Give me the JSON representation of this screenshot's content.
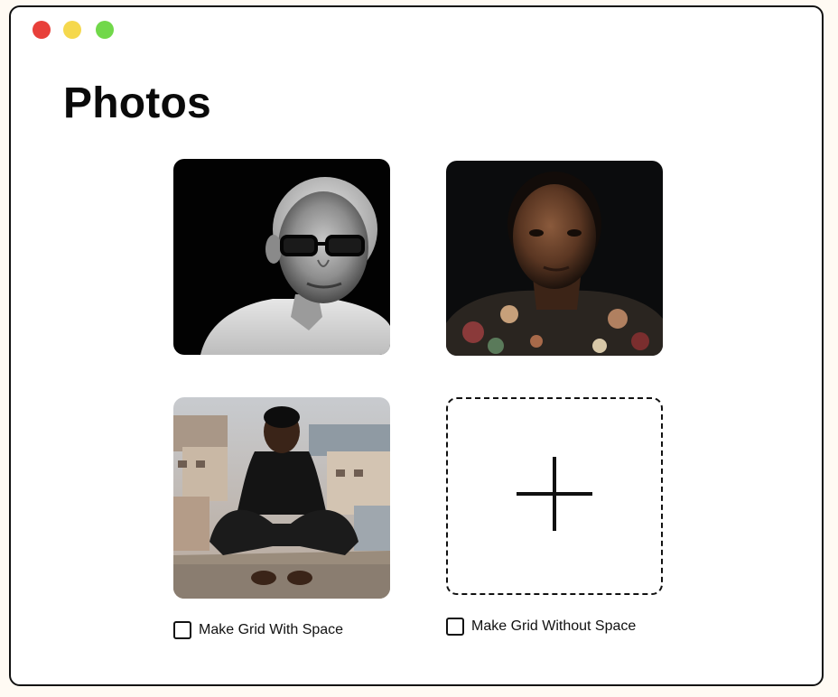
{
  "window": {
    "controls": [
      {
        "name": "close",
        "color": "#e8403a"
      },
      {
        "name": "minimize",
        "color": "#f5d84d"
      },
      {
        "name": "maximize",
        "color": "#71d84a"
      }
    ]
  },
  "page": {
    "title": "Photos"
  },
  "photos": [
    {
      "subject": "elderly man with glasses, black and white portrait",
      "alt": "portrait-photo-1"
    },
    {
      "subject": "young man in floral shirt, dark background portrait",
      "alt": "portrait-photo-2"
    },
    {
      "subject": "man in black sitting on rooftop over city",
      "alt": "portrait-photo-3"
    }
  ],
  "add_tile": {
    "icon": "plus-icon"
  },
  "options": [
    {
      "label": "Make Grid With Space",
      "checked": false
    },
    {
      "label": "Make Grid Without Space",
      "checked": false
    }
  ],
  "colors": {
    "border": "#111111",
    "background": "#ffffff",
    "outer_background": "#fffaf3"
  }
}
